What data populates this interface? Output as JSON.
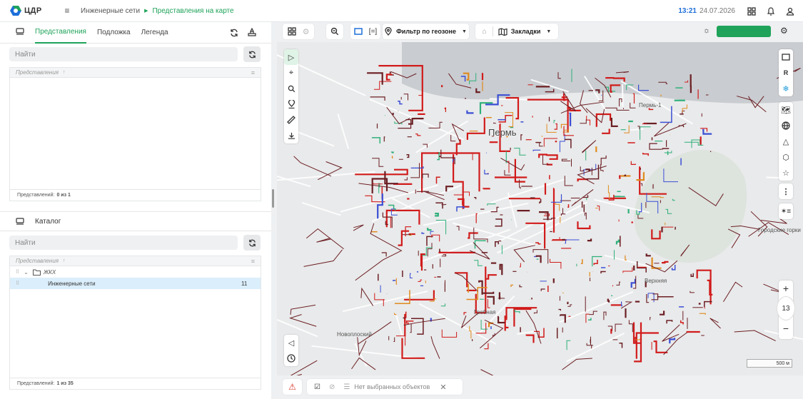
{
  "header": {
    "logo_text": "ЦДР",
    "breadcrumb_root": "Инженерные сети",
    "breadcrumb_current": "Представления на карте",
    "time": "13:21",
    "date": "24.07.2026"
  },
  "left_tabs": [
    {
      "label": "Представления"
    },
    {
      "label": "Подложка"
    },
    {
      "label": "Легенда"
    }
  ],
  "views_panel": {
    "search_placeholder": "Найти",
    "table_header": "Представления",
    "footer_label": "Представлений:",
    "footer_count": "0 из 1"
  },
  "catalog": {
    "title": "Каталог",
    "search_placeholder": "Найти",
    "table_header": "Представления",
    "folder": "ЖКХ",
    "item_name": "Инженерные сети",
    "item_count": "11",
    "footer_label": "Представлений:",
    "footer_count": "1 из 35"
  },
  "map_toolbar": {
    "filter_label": "Фильтр по геозоне",
    "bookmarks_label": "Закладки",
    "accent_color": "#1fa35a"
  },
  "map": {
    "labels": {
      "perm": "Пермь",
      "perm1": "Пермь-1",
      "gorodskie_gorki": "Городские горки",
      "verkhnyaya": "Верхняя",
      "grebnaya": "Гребная",
      "novoplosky": "Новоплоский"
    },
    "zoom": "13",
    "scale": "500 м",
    "right_tool_r": "R"
  },
  "status_bar": {
    "no_selection": "Нет выбранных объектов"
  }
}
